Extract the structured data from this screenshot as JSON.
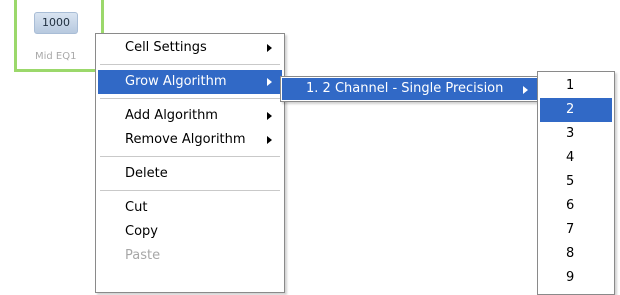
{
  "cell": {
    "value": "1000",
    "label": "Mid EQ1"
  },
  "context_menu": {
    "items": [
      {
        "label": "Cell Settings"
      },
      {
        "label": "Grow Algorithm"
      },
      {
        "label": "Add Algorithm"
      },
      {
        "label": "Remove Algorithm"
      },
      {
        "label": "Delete"
      },
      {
        "label": "Cut"
      },
      {
        "label": "Copy"
      },
      {
        "label": "Paste"
      }
    ]
  },
  "grow_submenu": {
    "items": [
      {
        "label": "1. 2 Channel - Single Precision"
      }
    ]
  },
  "channel_submenu": {
    "items": [
      {
        "label": "1"
      },
      {
        "label": "2"
      },
      {
        "label": "3"
      },
      {
        "label": "4"
      },
      {
        "label": "5"
      },
      {
        "label": "6"
      },
      {
        "label": "7"
      },
      {
        "label": "8"
      },
      {
        "label": "9"
      }
    ]
  },
  "colors": {
    "highlight": "#3169c6",
    "cell_border": "#9bd86b",
    "disabled_text": "#a7a7a7"
  }
}
